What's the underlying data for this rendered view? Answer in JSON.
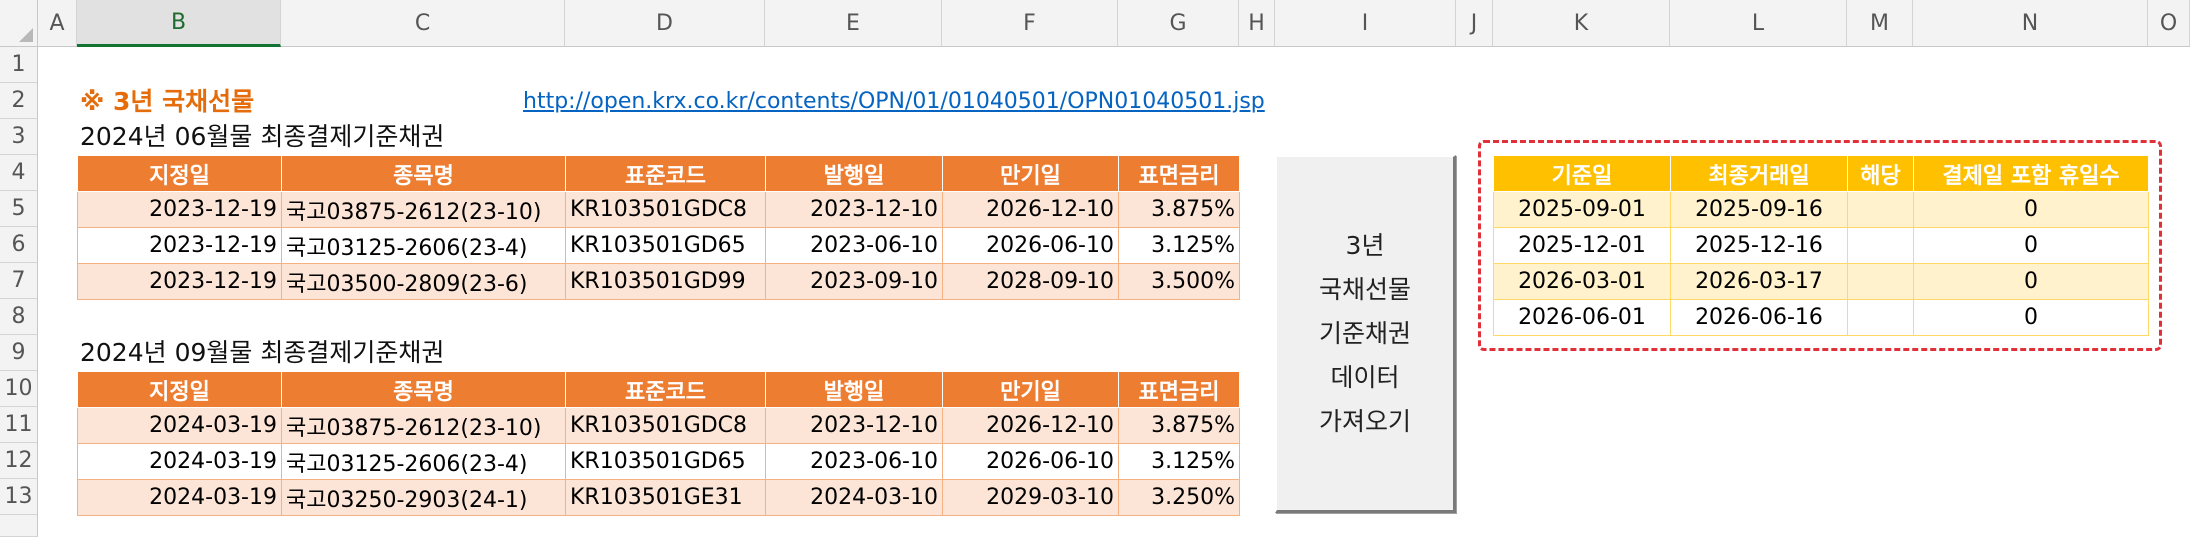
{
  "columns": [
    "A",
    "B",
    "C",
    "D",
    "E",
    "F",
    "G",
    "H",
    "I",
    "J",
    "K",
    "L",
    "M",
    "N",
    "O"
  ],
  "rows": [
    "1",
    "2",
    "3",
    "4",
    "5",
    "6",
    "7",
    "8",
    "9",
    "10",
    "11",
    "12",
    "13"
  ],
  "selected_column": "B",
  "sheet": {
    "title": "※ 3년 국채선물",
    "link": "http://open.krx.co.kr/contents/OPN/01/01040501/OPN01040501.jsp",
    "section1_title": "2024년 06월물 최종결제기준채권",
    "section2_title": "2024년 09월물 최종결제기준채권",
    "headers": [
      "지정일",
      "종목명",
      "표준코드",
      "발행일",
      "만기일",
      "표면금리"
    ],
    "table1": [
      [
        "2023-12-19",
        "국고03875-2612(23-10)",
        "KR103501GDC8",
        "2023-12-10",
        "2026-12-10",
        "3.875%"
      ],
      [
        "2023-12-19",
        "국고03125-2606(23-4)",
        "KR103501GD65",
        "2023-06-10",
        "2026-06-10",
        "3.125%"
      ],
      [
        "2023-12-19",
        "국고03500-2809(23-6)",
        "KR103501GD99",
        "2023-09-10",
        "2028-09-10",
        "3.500%"
      ]
    ],
    "table2": [
      [
        "2024-03-19",
        "국고03875-2612(23-10)",
        "KR103501GDC8",
        "2023-12-10",
        "2026-12-10",
        "3.875%"
      ],
      [
        "2024-03-19",
        "국고03125-2606(23-4)",
        "KR103501GD65",
        "2023-06-10",
        "2026-06-10",
        "3.125%"
      ],
      [
        "2024-03-19",
        "국고03250-2903(24-1)",
        "KR103501GE31",
        "2024-03-10",
        "2029-03-10",
        "3.250%"
      ]
    ],
    "button_lines": [
      "3년",
      "국채선물",
      "기준채권",
      "데이터",
      "가져오기"
    ],
    "right_headers": [
      "기준일",
      "최종거래일",
      "해당",
      "결제일 포함 휴일수"
    ],
    "right_table": [
      [
        "2025-09-01",
        "2025-09-16",
        "",
        "0"
      ],
      [
        "2025-12-01",
        "2025-12-16",
        "",
        "0"
      ],
      [
        "2026-03-01",
        "2026-03-17",
        "",
        "0"
      ],
      [
        "2026-06-01",
        "2026-06-16",
        "",
        "0"
      ]
    ]
  },
  "colors": {
    "orange_header": "#ed7d31",
    "orange_band": "#fce4d6",
    "gold_header": "#ffc000",
    "gold_band": "#fff2cc",
    "title_orange": "#e46c0a",
    "link_blue": "#0563c1",
    "highlight_red": "#e0303a"
  }
}
